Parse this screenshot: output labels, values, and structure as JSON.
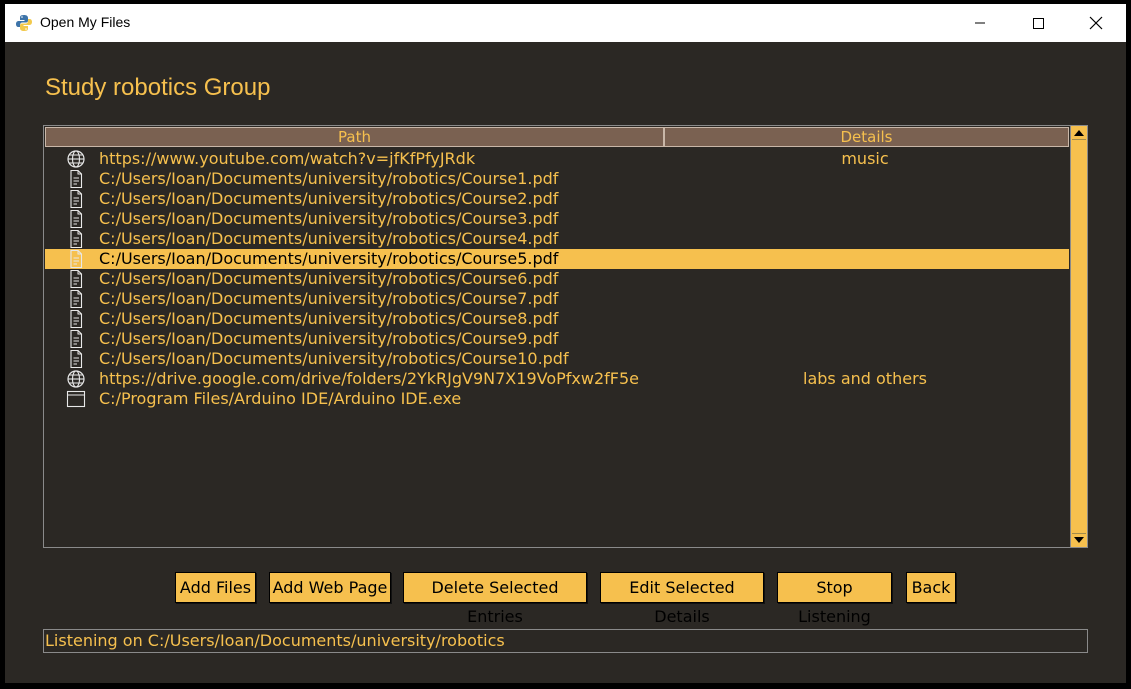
{
  "window": {
    "title": "Open My Files",
    "app_icon": "python-icon",
    "controls": [
      "minimize-icon",
      "maximize-icon",
      "close-icon"
    ]
  },
  "group_title": "Study robotics Group",
  "tree": {
    "columns": [
      "Path",
      "Details"
    ],
    "rows": [
      {
        "icon": "globe-icon",
        "path": "https://www.youtube.com/watch?v=jfKfPfyJRdk",
        "details": "music",
        "selected": false
      },
      {
        "icon": "document-icon",
        "path": "C:/Users/Ioan/Documents/university/robotics/Course1.pdf",
        "details": "",
        "selected": false
      },
      {
        "icon": "document-icon",
        "path": "C:/Users/Ioan/Documents/university/robotics/Course2.pdf",
        "details": "",
        "selected": false
      },
      {
        "icon": "document-icon",
        "path": "C:/Users/Ioan/Documents/university/robotics/Course3.pdf",
        "details": "",
        "selected": false
      },
      {
        "icon": "document-icon",
        "path": "C:/Users/Ioan/Documents/university/robotics/Course4.pdf",
        "details": "",
        "selected": false
      },
      {
        "icon": "document-icon",
        "path": "C:/Users/Ioan/Documents/university/robotics/Course5.pdf",
        "details": "",
        "selected": true
      },
      {
        "icon": "document-icon",
        "path": "C:/Users/Ioan/Documents/university/robotics/Course6.pdf",
        "details": "",
        "selected": false
      },
      {
        "icon": "document-icon",
        "path": "C:/Users/Ioan/Documents/university/robotics/Course7.pdf",
        "details": "",
        "selected": false
      },
      {
        "icon": "document-icon",
        "path": "C:/Users/Ioan/Documents/university/robotics/Course8.pdf",
        "details": "",
        "selected": false
      },
      {
        "icon": "document-icon",
        "path": "C:/Users/Ioan/Documents/university/robotics/Course9.pdf",
        "details": "",
        "selected": false
      },
      {
        "icon": "document-icon",
        "path": "C:/Users/Ioan/Documents/university/robotics/Course10.pdf",
        "details": "",
        "selected": false
      },
      {
        "icon": "globe-icon",
        "path": "https://drive.google.com/drive/folders/2YkRJgV9N7X19VoPfxw2fF5e",
        "details": "labs and others",
        "selected": false
      },
      {
        "icon": "window-icon",
        "path": "C:/Program Files/Arduino IDE/Arduino IDE.exe",
        "details": "",
        "selected": false
      }
    ]
  },
  "buttons": {
    "add_files": "Add Files",
    "add_web_page": "Add Web Page",
    "delete_selected": "Delete Selected Entries",
    "edit_details": "Edit Selected Details",
    "stop_listening": "Stop Listening",
    "back": "Back"
  },
  "status": "Listening on C:/Users/Ioan/Documents/university/robotics",
  "colors": {
    "accent": "#f6c04e",
    "background": "#2b2824",
    "header": "#7a6151"
  }
}
